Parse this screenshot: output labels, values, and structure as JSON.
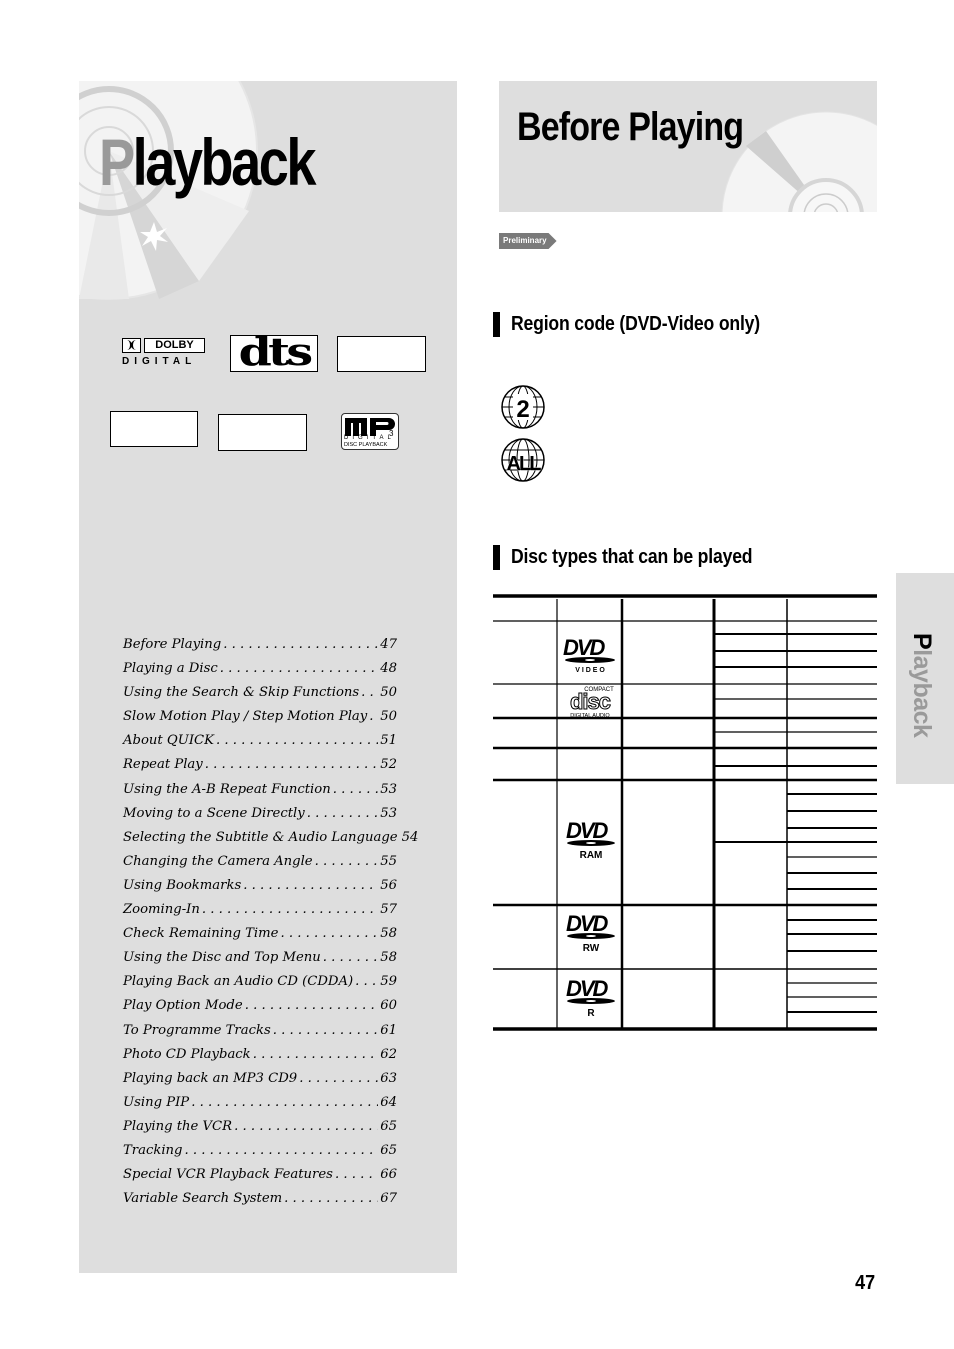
{
  "left_panel": {
    "chapter_title_first": "P",
    "chapter_title_rest": "layback",
    "logos": {
      "dolby_word": "DOLBY",
      "dolby_sub": "DIGITAL",
      "dts": "dts",
      "mp3_sub1": "DIGITAL",
      "mp3_sub2": "DISC PLAYBACK"
    },
    "toc": [
      {
        "title": "Before Playing",
        "page": "47"
      },
      {
        "title": "Playing a Disc",
        "page": "48"
      },
      {
        "title": "Using the Search & Skip Functions",
        "page": "50"
      },
      {
        "title": "Slow Motion Play / Step Motion Play",
        "page": "50"
      },
      {
        "title": "About QUICK",
        "page": "51"
      },
      {
        "title": "Repeat Play",
        "page": "52"
      },
      {
        "title": "Using the A-B Repeat Function",
        "page": "53"
      },
      {
        "title": "Moving to a Scene Directly",
        "page": "53"
      },
      {
        "title": "Selecting the Subtitle & Audio Language",
        "page": "54"
      },
      {
        "title": "Changing the Camera Angle",
        "page": "55"
      },
      {
        "title": "Using Bookmarks",
        "page": "56"
      },
      {
        "title": "Zooming-In",
        "page": "57"
      },
      {
        "title": "Check Remaining Time",
        "page": "58"
      },
      {
        "title": "Using the Disc and Top Menu",
        "page": "58"
      },
      {
        "title": "Playing Back an Audio CD (CDDA)",
        "page": "59"
      },
      {
        "title": "Play Option Mode",
        "page": "60"
      },
      {
        "title": "To Programme Tracks",
        "page": "61"
      },
      {
        "title": "Photo CD Playback",
        "page": "62"
      },
      {
        "title": "Playing back an MP3 CD9",
        "page": "63"
      },
      {
        "title": "Using PIP",
        "page": "64"
      },
      {
        "title": "Playing the VCR",
        "page": "65"
      },
      {
        "title": "Tracking",
        "page": "65"
      },
      {
        "title": "Special VCR Playback Features",
        "page": "66"
      },
      {
        "title": "Variable Search System",
        "page": "67"
      }
    ]
  },
  "right": {
    "section_title": "Before Playing",
    "preliminary_tag": "Preliminary",
    "region_heading": "Region code (DVD-Video only)",
    "region_icons": [
      "2",
      "ALL"
    ],
    "disc_heading": "Disc types that can be played",
    "disc_logos": {
      "dvd_video_sub": "V I D E O",
      "cd_top": "COMPACT",
      "cd_main": "disc",
      "cd_sub": "DIGITAL AUDIO",
      "dvd_ram_sub": "RAM",
      "dvd_rw_sub": "RW",
      "dvd_r_sub": "R"
    }
  },
  "side_tab": {
    "first": "P",
    "rest": "layback"
  },
  "page_number": "47"
}
